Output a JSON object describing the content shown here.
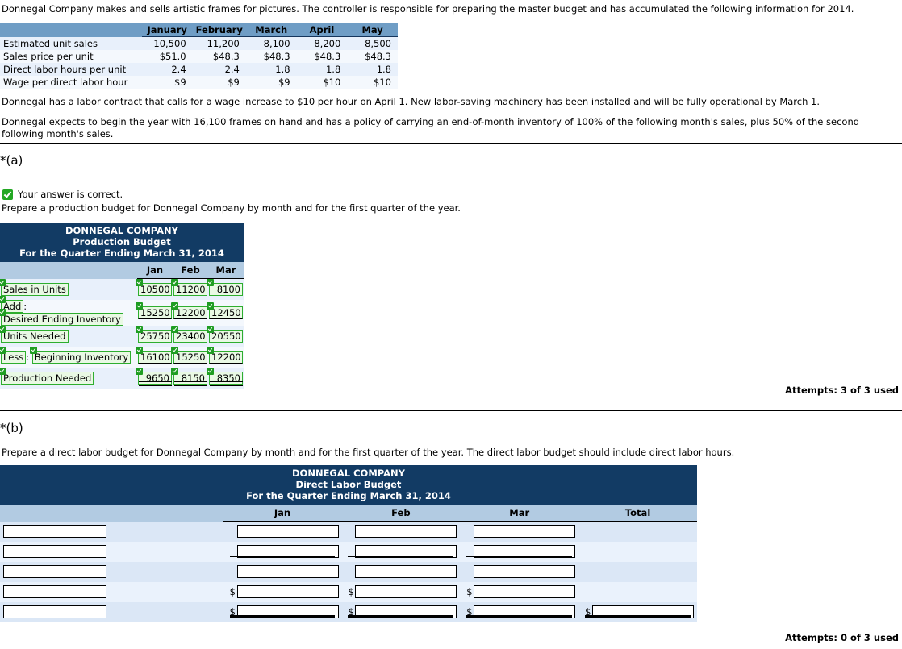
{
  "intro": {
    "text": "Donnegal Company makes and sells artistic frames for pictures. The controller is responsible for preparing the master budget and has accumulated the following information for 2014."
  },
  "given_table": {
    "row_label_header": "",
    "columns": [
      "January",
      "February",
      "March",
      "April",
      "May"
    ],
    "rows": [
      {
        "label": "Estimated unit sales",
        "values": [
          "10,500",
          "11,200",
          "8,100",
          "8,200",
          "8,500"
        ]
      },
      {
        "label": "Sales price per unit",
        "values": [
          "$51.0",
          "$48.3",
          "$48.3",
          "$48.3",
          "$48.3"
        ]
      },
      {
        "label": "Direct labor hours per unit",
        "values": [
          "2.4",
          "2.4",
          "1.8",
          "1.8",
          "1.8"
        ]
      },
      {
        "label": "Wage per direct labor hour",
        "values": [
          "$9",
          "$9",
          "$9",
          "$10",
          "$10"
        ]
      }
    ]
  },
  "paragraphs": {
    "p1": "Donnegal has a labor contract that calls for a wage increase to $10 per hour on April 1. New labor-saving machinery has been installed and will be fully operational by March 1.",
    "p2": "Donnegal expects to begin the year with 16,100 frames on hand and has a policy of carrying an end-of-month inventory of 100% of the following month's sales, plus 50% of the second following month's sales."
  },
  "part_a": {
    "label": "*(a)",
    "correct_message": "Your answer is correct.",
    "instruction": "Prepare a production budget for Donnegal Company by month and for the first quarter of the year.",
    "table": {
      "title_line1": "DONNEGAL COMPANY",
      "title_line2": "Production Budget",
      "title_line3": "For the Quarter Ending March 31, 2014",
      "columns": [
        "Jan",
        "Feb",
        "Mar"
      ],
      "rows": [
        {
          "prefix": "",
          "label": "Sales in Units",
          "values": [
            "10500",
            "11200",
            "8100"
          ],
          "rule": "none"
        },
        {
          "prefix": "Add",
          "separator": ":",
          "label": "Desired Ending Inventory",
          "values": [
            "15250",
            "12200",
            "12450"
          ],
          "rule": "single"
        },
        {
          "prefix": "",
          "label": "Units Needed",
          "values": [
            "25750",
            "23400",
            "20550"
          ],
          "rule": "none"
        },
        {
          "prefix": "Less",
          "separator": ":",
          "label": "Beginning Inventory",
          "values": [
            "16100",
            "15250",
            "12200"
          ],
          "rule": "single"
        },
        {
          "prefix": "",
          "label": "Production Needed",
          "values": [
            "9650",
            "8150",
            "8350"
          ],
          "rule": "double"
        }
      ]
    },
    "attempts": "Attempts: 3 of 3 used"
  },
  "part_b": {
    "label": "*(b)",
    "instruction": "Prepare a direct labor budget for Donnegal Company by month and for the first quarter of the year. The direct labor budget should include direct labor hours.",
    "table": {
      "title_line1": "DONNEGAL COMPANY",
      "title_line2": "Direct Labor Budget",
      "title_line3": "For the Quarter Ending March 31, 2014",
      "columns": [
        "Jan",
        "Feb",
        "Mar",
        "Total"
      ],
      "rows": [
        {
          "label_value": "",
          "label_placeholder": "",
          "cells": [
            {
              "value": "",
              "dollar": false,
              "rule": "none"
            },
            {
              "value": "",
              "dollar": false,
              "rule": "none"
            },
            {
              "value": "",
              "dollar": false,
              "rule": "none"
            },
            {
              "value": null,
              "dollar": false,
              "rule": "none"
            }
          ]
        },
        {
          "label_value": "",
          "label_placeholder": "",
          "cells": [
            {
              "value": "",
              "dollar": false,
              "rule": "thin"
            },
            {
              "value": "",
              "dollar": false,
              "rule": "thin"
            },
            {
              "value": "",
              "dollar": false,
              "rule": "thin"
            },
            {
              "value": null,
              "dollar": false,
              "rule": "none"
            }
          ]
        },
        {
          "label_value": "",
          "label_placeholder": "",
          "cells": [
            {
              "value": "",
              "dollar": false,
              "rule": "none"
            },
            {
              "value": "",
              "dollar": false,
              "rule": "none"
            },
            {
              "value": "",
              "dollar": false,
              "rule": "none"
            },
            {
              "value": null,
              "dollar": false,
              "rule": "none"
            }
          ]
        },
        {
          "label_value": "",
          "label_placeholder": "",
          "cells": [
            {
              "value": "",
              "dollar": true,
              "rule": "thin"
            },
            {
              "value": "",
              "dollar": true,
              "rule": "thin"
            },
            {
              "value": "",
              "dollar": true,
              "rule": "thin"
            },
            {
              "value": null,
              "dollar": false,
              "rule": "none"
            }
          ]
        },
        {
          "label_value": "",
          "label_placeholder": "",
          "cells": [
            {
              "value": "",
              "dollar": true,
              "rule": "thick"
            },
            {
              "value": "",
              "dollar": true,
              "rule": "thick"
            },
            {
              "value": "",
              "dollar": true,
              "rule": "thick"
            },
            {
              "value": "",
              "dollar": true,
              "rule": "thick"
            }
          ]
        }
      ],
      "dollar_sign": "$"
    },
    "attempts": "Attempts: 0 of 3 used"
  },
  "colors": {
    "navy": "#123b64",
    "header_blue": "#6f9dc5",
    "colhead_blue": "#b2cbe2",
    "row_light": "#e8f0fb",
    "row_lighter": "#f4f8fd",
    "answer_green_border": "#2eae2e",
    "answer_green_bg": "#e9f9e4",
    "check_green": "#1f9d22"
  }
}
